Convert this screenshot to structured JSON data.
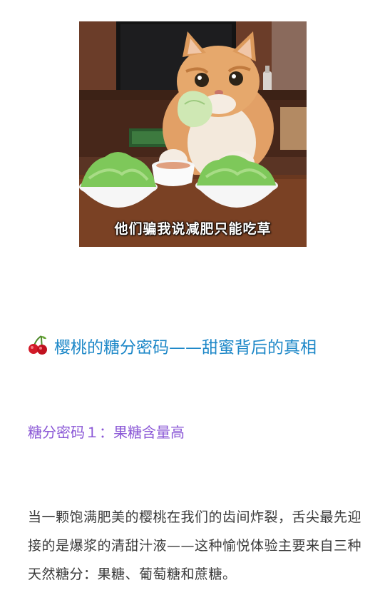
{
  "image": {
    "caption": "他们骗我说减肥只能吃草",
    "icon": "cat-eating-lettuce-photo"
  },
  "heading": {
    "icon": "cherry-icon",
    "text": "樱桃的糖分密码——甜蜜背后的真相",
    "color": "#1e88c8"
  },
  "subheading": {
    "text": "糖分密码１：果糖含量高",
    "color": "#8a57d6"
  },
  "paragraph": {
    "text": "当一颗饱满肥美的樱桃在我们的齿间炸裂，舌尖最先迎接的是爆浆的清甜汁液——这种愉悦体验主要来自三种天然糖分：果糖、葡萄糖和蔗糖。"
  }
}
